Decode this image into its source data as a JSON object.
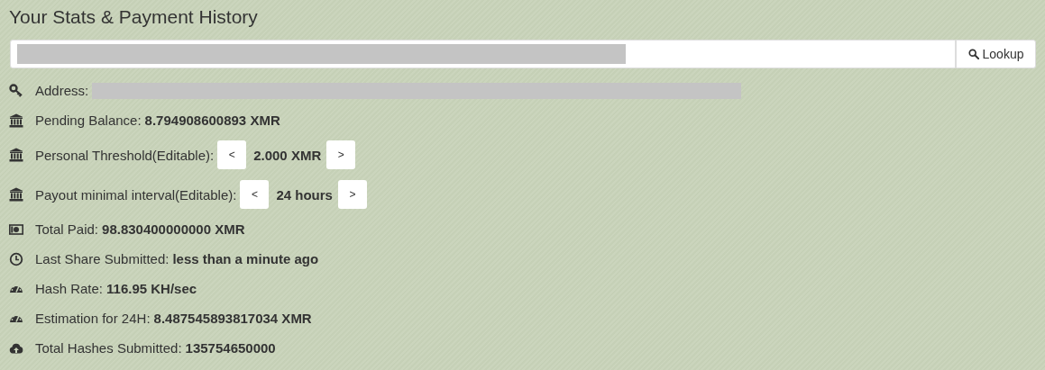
{
  "title": "Your Stats & Payment History",
  "search": {
    "button": "Lookup",
    "redacted": true
  },
  "rows": [
    {
      "kind": "redacted",
      "label": "Address:"
    },
    {
      "kind": "value",
      "label": "Pending Balance:",
      "value": "8.794908600893 XMR"
    },
    {
      "kind": "stepper",
      "label": "Personal Threshold(Editable):",
      "prev": "<",
      "value": "2.000 XMR",
      "next": ">"
    },
    {
      "kind": "stepper",
      "label": "Payout minimal interval(Editable):",
      "prev": "<",
      "value": "24 hours",
      "next": ">"
    },
    {
      "kind": "value",
      "label": "Total Paid:",
      "value": "98.830400000000 XMR"
    },
    {
      "kind": "value",
      "label": "Last Share Submitted:",
      "value": "less than a minute ago"
    },
    {
      "kind": "value",
      "label": "Hash Rate:",
      "value": "116.95 KH/sec"
    },
    {
      "kind": "value",
      "label": "Estimation for 24H:",
      "value": "8.487545893817034 XMR"
    },
    {
      "kind": "value",
      "label": "Total Hashes Submitted:",
      "value": "135754650000"
    }
  ]
}
